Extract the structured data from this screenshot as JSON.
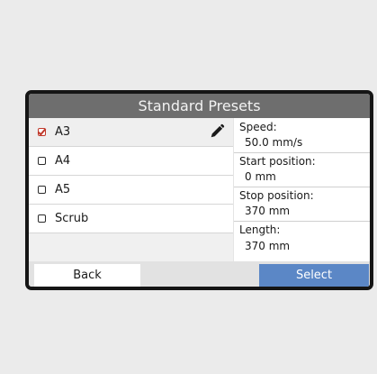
{
  "dialog": {
    "title": "Standard Presets"
  },
  "presets": [
    {
      "label": "A3",
      "checked": true
    },
    {
      "label": "A4",
      "checked": false
    },
    {
      "label": "A5",
      "checked": false
    },
    {
      "label": "Scrub",
      "checked": false
    }
  ],
  "details": {
    "speed_label": "Speed:",
    "speed_value": "50.0 mm/s",
    "start_label": "Start position:",
    "start_value": "0 mm",
    "stop_label": "Stop position:",
    "stop_value": "370 mm",
    "length_label": "Length:",
    "length_value": "370 mm"
  },
  "buttons": {
    "back_label": "Back",
    "select_label": "Select"
  },
  "colors": {
    "title_bar": "#6e6e6e",
    "select_button": "#5b87c6",
    "check_mark": "#c0392b"
  },
  "icons": {
    "edit": "pencil-icon"
  }
}
